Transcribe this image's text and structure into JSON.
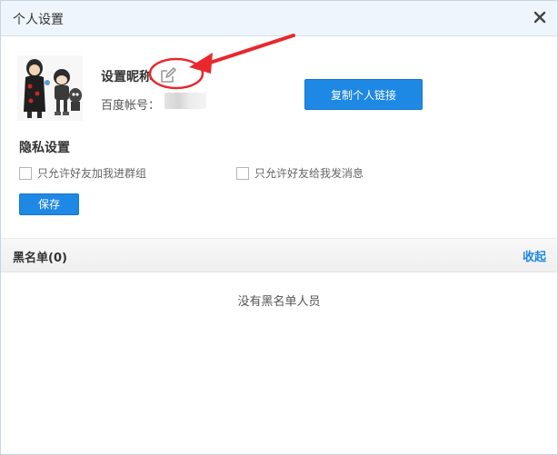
{
  "window": {
    "title": "个人设置",
    "close_icon": "close-icon"
  },
  "profile": {
    "nickname_label": "设置昵称",
    "edit_icon": "edit-pencil-icon",
    "account_label": "百度帐号：",
    "copy_link_label": "复制个人链接"
  },
  "privacy": {
    "title": "隐私设置",
    "options": [
      {
        "label": "只允许好友加我进群组",
        "checked": false
      },
      {
        "label": "只允许好友给我发消息",
        "checked": false
      }
    ],
    "save_label": "保存"
  },
  "blacklist": {
    "title": "黑名单(0)",
    "collapse_label": "收起",
    "empty_text": "没有黑名单人员"
  },
  "colors": {
    "accent": "#1e88e5",
    "title_bar": "#eef5fc",
    "annotation": "#e8282d"
  }
}
